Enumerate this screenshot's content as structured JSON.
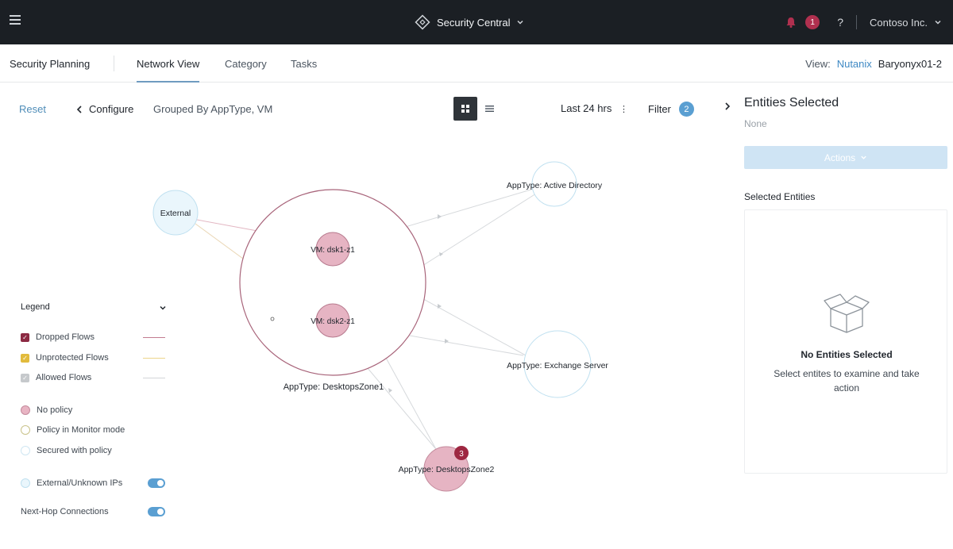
{
  "topbar": {
    "app_title": "Security Central",
    "notification_count": "1",
    "help": "?",
    "org": "Contoso Inc."
  },
  "nav": {
    "section": "Security Planning",
    "tabs": [
      {
        "label": "Network View",
        "active": true
      },
      {
        "label": "Category",
        "active": false
      },
      {
        "label": "Tasks",
        "active": false
      }
    ],
    "view_label": "View:",
    "view_link": "Nutanix",
    "view_value": "Baryonyx01-2"
  },
  "toolbar": {
    "reset": "Reset",
    "configure": "Configure",
    "grouped_by": "Grouped By AppType, VM",
    "time_range": "Last 24 hrs",
    "filter_label": "Filter",
    "filter_count": "2"
  },
  "graph": {
    "nodes": {
      "external": "External",
      "active_directory": "AppType: Active Directory",
      "vm1": "VM: dsk1-z1",
      "vm2": "VM: dsk2-z1",
      "zone1": "AppType: DesktopsZone1",
      "exchange": "AppType: Exchange Server",
      "zone2": "AppType: DesktopsZone2",
      "zone2_badge": "3"
    }
  },
  "legend": {
    "title": "Legend",
    "flows": [
      {
        "label": "Dropped Flows",
        "color": "#8c2a43"
      },
      {
        "label": "Unprotected Flows",
        "color": "#e2bb3c"
      },
      {
        "label": "Allowed Flows",
        "color": "#c6c9cc"
      }
    ],
    "policies": [
      {
        "label": "No policy",
        "color": "#e8b4c3"
      },
      {
        "label": "Policy in Monitor mode",
        "color": "#c9c38a"
      },
      {
        "label": "Secured with policy",
        "color": "#d7edf7"
      }
    ],
    "toggles": [
      {
        "label": "External/Unknown IPs"
      },
      {
        "label": "Next-Hop Connections"
      }
    ]
  },
  "panel": {
    "title": "Entities Selected",
    "selection": "None",
    "actions": "Actions",
    "selected_title": "Selected Entities",
    "empty_title": "No Entities Selected",
    "empty_sub": "Select entites to examine and take action"
  }
}
